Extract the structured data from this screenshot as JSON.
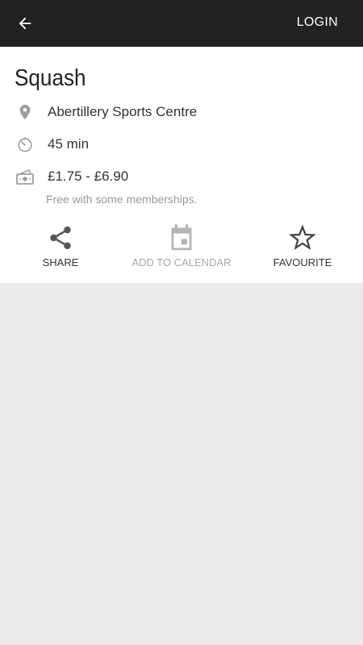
{
  "header": {
    "back_icon": "arrow-left-icon",
    "login_label": "LOGIN"
  },
  "activity": {
    "title": "Squash",
    "location": "Abertillery Sports Centre",
    "duration": "45 min",
    "price": "£1.75 - £6.90",
    "price_note": "Free with some memberships."
  },
  "actions": {
    "share_label": "SHARE",
    "calendar_label": "ADD TO CALENDAR",
    "favourite_label": "FAVOURITE"
  },
  "colors": {
    "topbar": "#222222",
    "background": "#ebebeb",
    "card": "#ffffff",
    "disabled": "#a8a8a8"
  }
}
